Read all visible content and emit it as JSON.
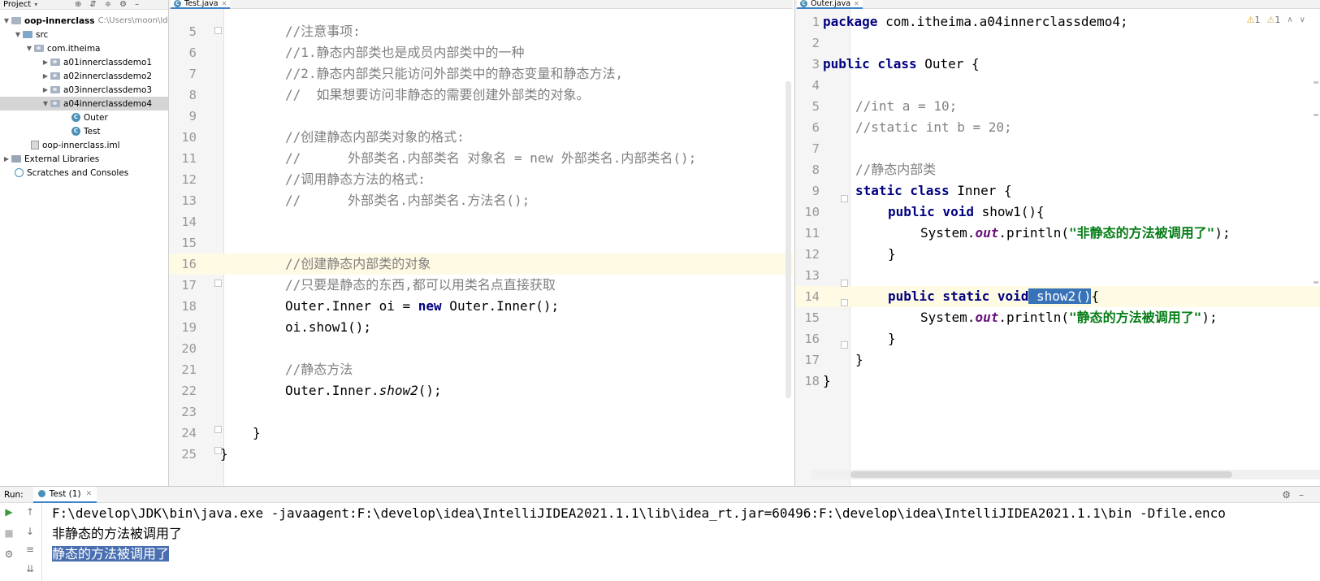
{
  "project": {
    "header_title": "Project",
    "items": [
      {
        "label": "oop-innerclass",
        "path": "C:\\Users\\moon\\Id"
      },
      {
        "label": "src"
      },
      {
        "label": "com.itheima"
      },
      {
        "label": "a01innerclassdemo1"
      },
      {
        "label": "a02innerclassdemo2"
      },
      {
        "label": "a03innerclassdemo3"
      },
      {
        "label": "a04innerclassdemo4"
      },
      {
        "label": "Outer"
      },
      {
        "label": "Test"
      },
      {
        "label": "oop-innerclass.iml"
      },
      {
        "label": "External Libraries"
      },
      {
        "label": "Scratches and Consoles"
      }
    ]
  },
  "left_editor": {
    "tab_label": "Test.java",
    "lines": [
      {
        "n": "5",
        "t": "//注意事项:"
      },
      {
        "n": "6",
        "t": "//1.静态内部类也是成员内部类中的一种"
      },
      {
        "n": "7",
        "t": "//2.静态内部类只能访问外部类中的静态变量和静态方法,"
      },
      {
        "n": "8",
        "t": "//  如果想要访问非静态的需要创建外部类的对象。"
      },
      {
        "n": "9",
        "t": ""
      },
      {
        "n": "10",
        "t": "//创建静态内部类对象的格式:"
      },
      {
        "n": "11",
        "t": "//      外部类名.内部类名 对象名 = new 外部类名.内部类名();"
      },
      {
        "n": "12",
        "t": "//调用静态方法的格式:"
      },
      {
        "n": "13",
        "t": "//      外部类名.内部类名.方法名();"
      },
      {
        "n": "14",
        "t": ""
      },
      {
        "n": "15",
        "t": ""
      },
      {
        "n": "16",
        "t": "//创建静态内部类的对象"
      },
      {
        "n": "17",
        "t": "//只要是静态的东西,都可以用类名点直接获取"
      },
      {
        "n": "18",
        "a": "Outer.Inner oi = ",
        "kw": "new",
        "b": " Outer.Inner();"
      },
      {
        "n": "19",
        "t": "oi.show1();"
      },
      {
        "n": "20",
        "t": ""
      },
      {
        "n": "21",
        "t": "//静态方法"
      },
      {
        "n": "22",
        "a": "Outer.Inner.",
        "it": "show2",
        "b": "();"
      },
      {
        "n": "23",
        "t": ""
      },
      {
        "n": "24",
        "t": "}"
      },
      {
        "n": "25",
        "t": "}"
      }
    ]
  },
  "right_editor": {
    "tab_label": "Outer.java",
    "warnings": "1",
    "weak_warnings": "1",
    "lines": [
      {
        "n": "1",
        "kw": "package",
        "b": " com.itheima.a04innerclassdemo4;"
      },
      {
        "n": "2",
        "t": ""
      },
      {
        "n": "3",
        "kw": "public class",
        "b": " Outer {"
      },
      {
        "n": "4",
        "t": ""
      },
      {
        "n": "5",
        "cm": "//int a = 10;"
      },
      {
        "n": "6",
        "cm": "//static int b = 20;"
      },
      {
        "n": "7",
        "t": ""
      },
      {
        "n": "8",
        "cm": "//静态内部类"
      },
      {
        "n": "9",
        "kw": "static class",
        "b": " Inner {"
      },
      {
        "n": "10",
        "kw": "public void",
        "b": " show1(){"
      },
      {
        "n": "11",
        "a": "System.",
        "fld": "out",
        "b2": ".println(",
        "str": "\"非静态的方法被调用了\"",
        "c": ");"
      },
      {
        "n": "12",
        "t": "}"
      },
      {
        "n": "13",
        "t": ""
      },
      {
        "n": "14",
        "kw": "public static void",
        "hl": " show2()",
        "b": "{"
      },
      {
        "n": "15",
        "a": "System.",
        "fld": "out",
        "b2": ".println(",
        "str": "\"静态的方法被调用了\"",
        "c": ");"
      },
      {
        "n": "16",
        "t": "}"
      },
      {
        "n": "17",
        "t": "}"
      },
      {
        "n": "18",
        "t": "}"
      }
    ]
  },
  "run": {
    "label": "Run:",
    "tab_label": "Test (1)",
    "console": [
      "F:\\develop\\JDK\\bin\\java.exe -javaagent:F:\\develop\\idea\\IntelliJIDEA2021.1.1\\lib\\idea_rt.jar=60496:F:\\develop\\idea\\IntelliJIDEA2021.1.1\\bin -Dfile.enco",
      "非静态的方法被调用了",
      "静态的方法被调用了"
    ]
  },
  "colors": {
    "keyword": "#000080",
    "comment": "#808080",
    "string": "#067d17",
    "selection": "#3873b8"
  }
}
